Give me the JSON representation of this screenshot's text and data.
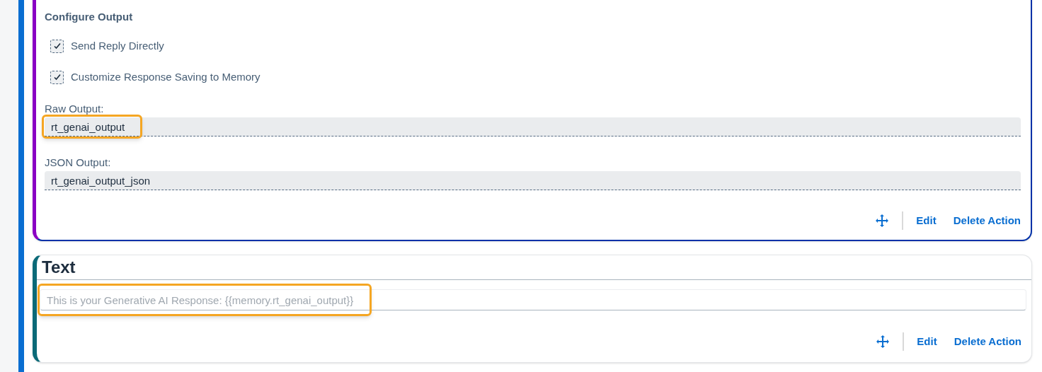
{
  "output_card": {
    "heading": "Configure Output",
    "options": [
      {
        "label": "Send Reply Directly",
        "checked": true
      },
      {
        "label": "Customize Response Saving to Memory",
        "checked": true
      }
    ],
    "fields": [
      {
        "label": "Raw Output:",
        "value": "rt_genai_output",
        "highlighted": true
      },
      {
        "label": "JSON Output:",
        "value": "rt_genai_output_json",
        "highlighted": false
      }
    ],
    "actions": [
      "Edit",
      "Delete Action"
    ]
  },
  "text_card": {
    "title": "Text",
    "placeholder": "This is your Generative AI Response: {{memory.rt_genai_output}}",
    "highlighted": true,
    "actions": [
      "Edit",
      "Delete Action"
    ]
  }
}
